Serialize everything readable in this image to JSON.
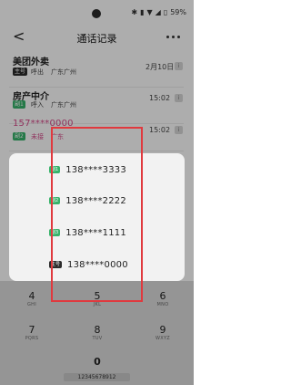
{
  "status_bar": {
    "time": "",
    "battery_text": "59%",
    "icons": [
      "bluetooth-icon",
      "vibrate-icon",
      "wifi-icon",
      "signal-icon",
      "battery-icon"
    ]
  },
  "header": {
    "title": "通话记录"
  },
  "records": [
    {
      "name": "美团外卖",
      "tag": "主号",
      "direction": "呼出",
      "location": "广东广州",
      "time": "2月10日"
    },
    {
      "name": "房产中介",
      "tag": "副1",
      "direction": "呼入",
      "location": "广东广州",
      "time": "15:02"
    },
    {
      "name": "157****0000",
      "tag": "副2",
      "direction": "未接",
      "location": "广东",
      "time": "15:02"
    }
  ],
  "dialog": {
    "options": [
      {
        "badge": "副1",
        "number": "138****3333"
      },
      {
        "badge": "副2",
        "number": "138****2222"
      },
      {
        "badge": "副3",
        "number": "138****1111"
      },
      {
        "badge": "主号",
        "number": "138****0000"
      }
    ]
  },
  "keypad": {
    "rows": [
      [
        {
          "digit": "4",
          "letters": "GHI"
        },
        {
          "digit": "5",
          "letters": "JKL"
        },
        {
          "digit": "6",
          "letters": "MNO"
        }
      ],
      [
        {
          "digit": "7",
          "letters": "PQRS"
        },
        {
          "digit": "8",
          "letters": "TUV"
        },
        {
          "digit": "9",
          "letters": "WXYZ"
        }
      ],
      [
        {
          "digit": "0",
          "letters": ""
        }
      ]
    ],
    "number_display": "12345678912"
  },
  "colors": {
    "highlight": "#e0393e",
    "accent_pink": "#d64a8a",
    "tag_green": "#37b36a",
    "tag_dark": "#2b2b2b"
  }
}
